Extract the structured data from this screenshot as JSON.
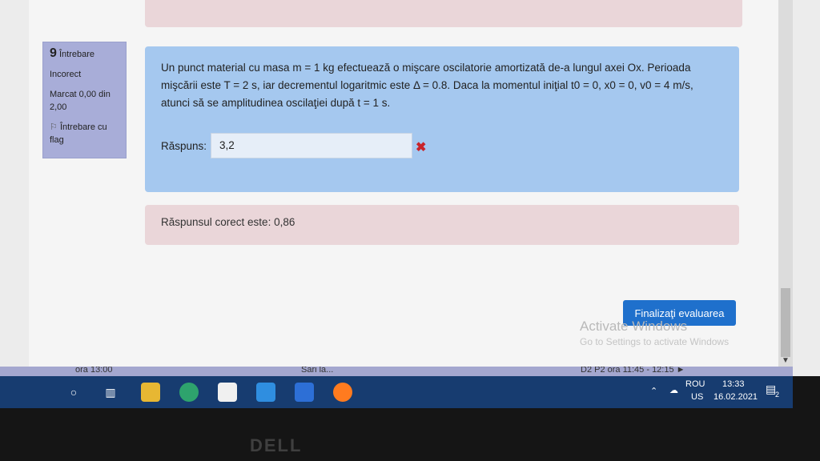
{
  "question": {
    "number": "9",
    "word": "Întrebare",
    "status": "Incorect",
    "mark": "Marcat 0,00 din 2,00",
    "flag_label": "Întrebare cu flag",
    "text_line1": "Un punct material cu masa m = 1 kg efectuează o mişcare oscilatorie amortizată de-a lungul axei Ox. Perioada",
    "text_line2": "mişcării este T = 2 s, iar decrementul logaritmic este Δ = 0.8. Daca la momentul iniţial t0 = 0, x0 = 0, v0 = 4 m/s,",
    "text_line3": "atunci să se amplitudinea oscilaţiei după t = 1 s.",
    "answer_label": "Răspuns:",
    "answer_value": "3,2",
    "wrong_icon": "close-icon",
    "correct_answer": "Răspunsul corect este: 0,86"
  },
  "actions": {
    "finish_label": "Finalizaţi evaluarea"
  },
  "watermark": {
    "line1": "Activate Windows",
    "line2": "Go to Settings to activate Windows"
  },
  "bottom_strip": {
    "left": "ora 13:00",
    "middle": "Sari la...",
    "right": "D2 P2 ora 11:45 - 12:15 ►"
  },
  "taskbar": {
    "lang_top": "ROU",
    "lang_bottom": "US",
    "time": "13:33",
    "date": "16.02.2021",
    "notification_count": "2"
  },
  "bezel": {
    "brand": "DELL"
  },
  "colors": {
    "question_bg": "#a5c8ef",
    "feedback_bg": "#ead6d9",
    "info_bg": "#a8add8",
    "button_bg": "#1f70cc",
    "taskbar_bg": "#173c70"
  }
}
